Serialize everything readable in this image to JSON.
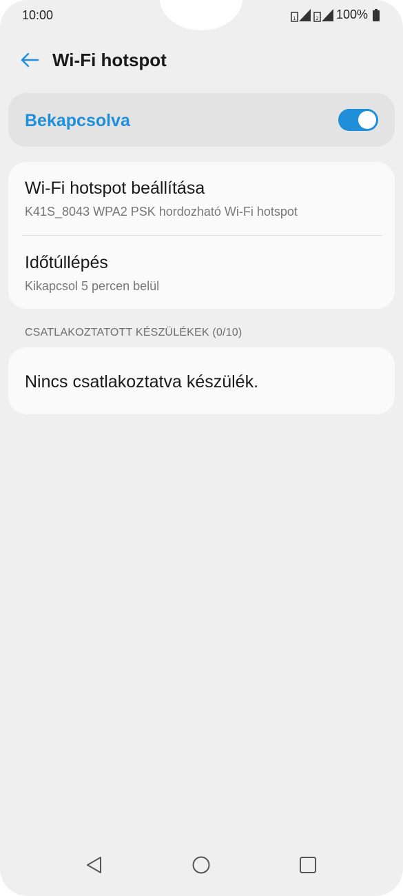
{
  "status_bar": {
    "time": "10:00",
    "battery_text": "100%",
    "icons": [
      "signal-sim1-icon",
      "signal-sim2-icon",
      "battery-icon"
    ]
  },
  "app_bar": {
    "title": "Wi-Fi hotspot",
    "back_icon": "back-arrow-icon"
  },
  "master_switch": {
    "label": "Bekapcsolva",
    "state": "on"
  },
  "settings": {
    "items": [
      {
        "title": "Wi-Fi hotspot beállítása",
        "subtitle": "K41S_8043 WPA2 PSK hordozható Wi-Fi hotspot"
      },
      {
        "title": "Időtúllépés",
        "subtitle": "Kikapcsol 5 percen belül"
      }
    ]
  },
  "connected_devices": {
    "header": "CSATLAKOZTATOTT KÉSZÜLÉKEK (0/10)",
    "empty_text": "Nincs csatlakoztatva készülék."
  },
  "nav_bar": {
    "icons": [
      "back-triangle-icon",
      "home-circle-icon",
      "recents-square-icon"
    ]
  },
  "colors": {
    "accent": "#1f8fd9",
    "background": "#efefef",
    "card": "#fafafa",
    "master_card": "#e3e3e3"
  }
}
